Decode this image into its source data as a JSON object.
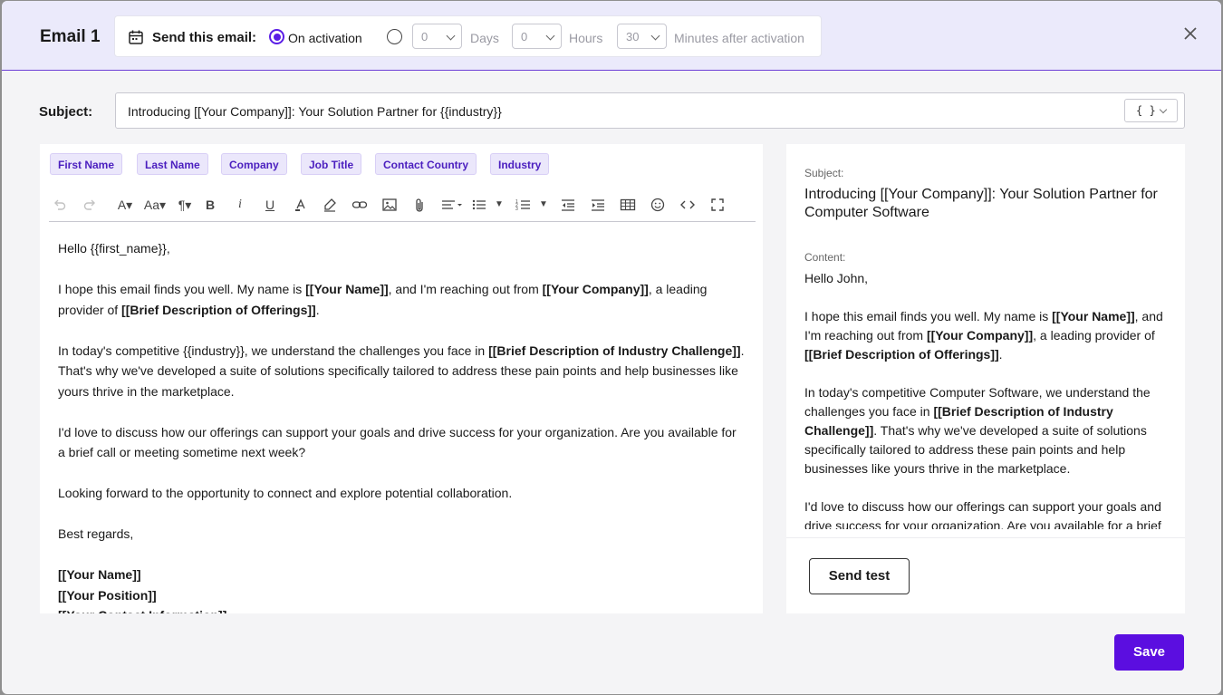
{
  "header": {
    "title": "Email 1",
    "send_label": "Send this email:",
    "on_activation": "On activation",
    "days_value": "0",
    "days_unit": "Days",
    "hours_value": "0",
    "hours_unit": "Hours",
    "minutes_value": "30",
    "minutes_unit": "Minutes after activation"
  },
  "subject": {
    "label": "Subject:",
    "value": "Introducing [[Your Company]]: Your Solution Partner for {{industry}}",
    "var_button": "{ }"
  },
  "tags": [
    "First Name",
    "Last Name",
    "Company",
    "Job Title",
    "Contact Country",
    "Industry"
  ],
  "editor": {
    "greeting": "Hello {{first_name}},",
    "p1_a": "I hope this email finds you well. My name is ",
    "p1_b": "[[Your Name]]",
    "p1_c": ", and I'm reaching out from ",
    "p1_d": "[[Your Company]]",
    "p1_e": ", a leading provider of ",
    "p1_f": "[[Brief Description of Offerings]]",
    "p1_g": ".",
    "p2_a": "In today's competitive {{industry}}, we understand the challenges you face in ",
    "p2_b": "[[Brief Description of Industry Challenge]]",
    "p2_c": ". That's why we've developed a suite of solutions specifically tailored to address these pain points and help businesses like yours thrive in the marketplace.",
    "p3": "I'd love to discuss how our offerings can support your goals and drive success for your organization. Are you available for a brief call or meeting sometime next week?",
    "p4": "Looking forward to the opportunity to connect and explore potential collaboration.",
    "closing": "Best regards,",
    "sig_name": "[[Your Name]]",
    "sig_position": "[[Your Position]]",
    "sig_contact": "[[Your Contact Information]]"
  },
  "preview": {
    "subject_label": "Subject:",
    "subject": "Introducing [[Your Company]]: Your Solution Partner for Computer Software",
    "content_label": "Content:",
    "greeting": "Hello John,",
    "p1_a": "I hope this email finds you well. My name is ",
    "p1_b": "[[Your Name]]",
    "p1_c": ", and I'm reaching out from ",
    "p1_d": "[[Your Company]]",
    "p1_e": ", a leading provider of ",
    "p1_f": "[[Brief Description of Offerings]]",
    "p1_g": ".",
    "p2_a": "In today's competitive Computer Software, we understand the challenges you face in ",
    "p2_b": "[[Brief Description of Industry Challenge]]",
    "p2_c": ". That's why we've developed a suite of solutions specifically tailored to address these pain points and help businesses like yours thrive in the marketplace.",
    "p3": "I'd love to discuss how our offerings can support your goals and drive success for your organization. Are you available for a brief call or meeting sometime next week?",
    "send_test": "Send test"
  },
  "save_label": "Save",
  "colors": {
    "accent": "#5b0ee0",
    "header_bg": "#ebeafb",
    "tag_bg": "#ebe7fb",
    "tag_text": "#4b1fbf"
  }
}
